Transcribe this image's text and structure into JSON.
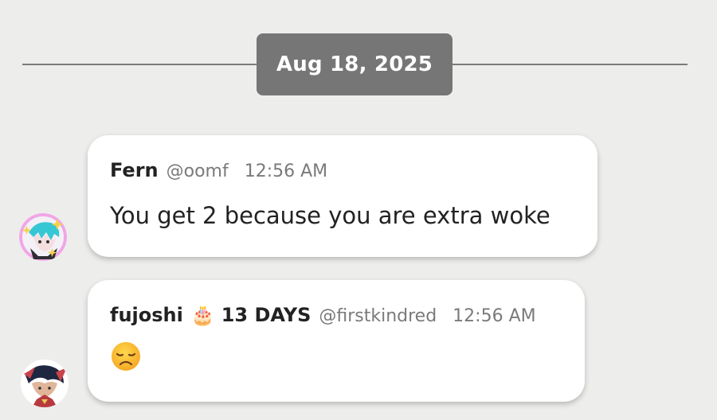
{
  "date_divider": {
    "label": "Aug 18, 2025"
  },
  "messages": [
    {
      "author": "Fern",
      "handle": "@oomf",
      "time": "12:56 AM",
      "text": "You get 2 because you are extra woke",
      "avatar_icon": "anime-character-avatar"
    },
    {
      "author": "fujoshi",
      "badge_icon": "birthday-cake-icon",
      "badge_text": "13 DAYS",
      "handle": "@firstkindred",
      "time": "12:56 AM",
      "emoji_icon": "disappointed-face-emoji",
      "avatar_icon": "character-avatar"
    }
  ],
  "colors": {
    "background": "#ededec",
    "date_pill": "#767676",
    "bubble": "#ffffff",
    "text_primary": "#222222",
    "text_secondary": "#7a7a7a"
  }
}
